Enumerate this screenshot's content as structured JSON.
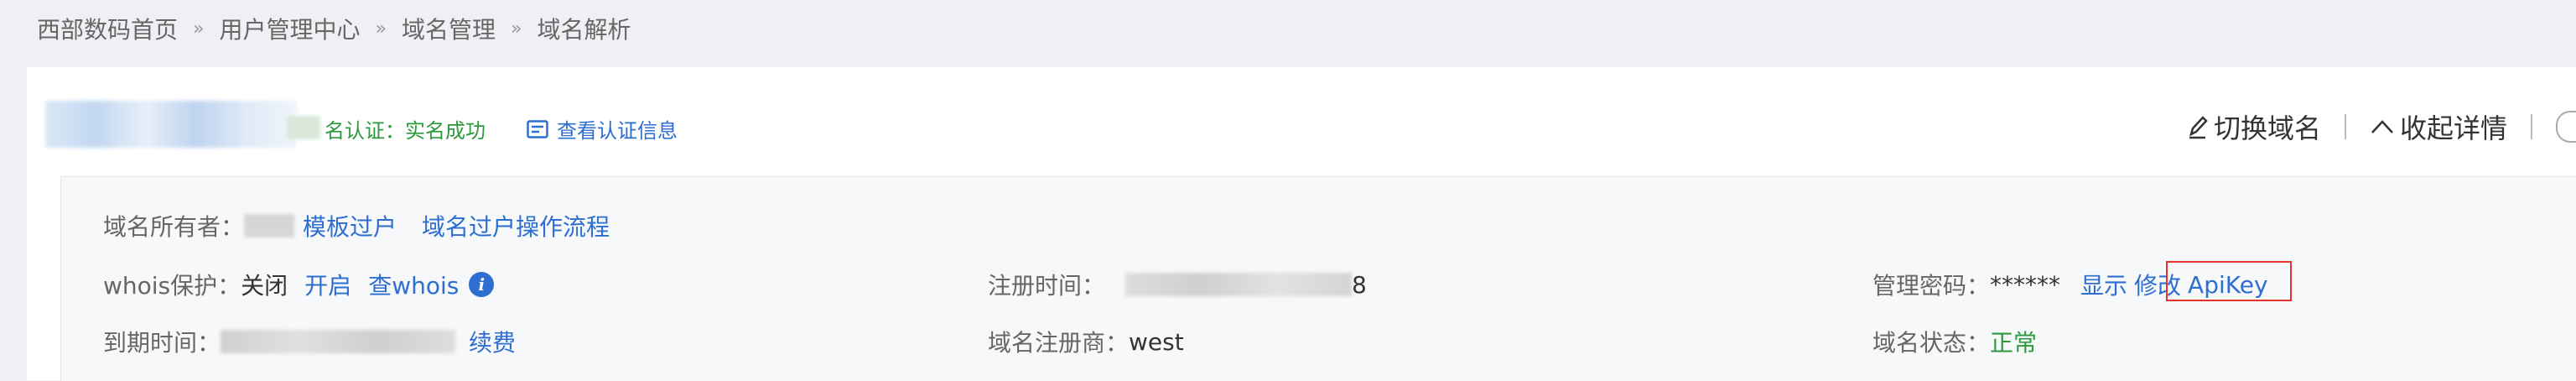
{
  "breadcrumb": [
    "西部数码首页",
    "用户管理中心",
    "域名管理",
    "域名解析"
  ],
  "header": {
    "auth_text": "名认证：实名成功",
    "auth_link": "查看认证信息",
    "switch_domain": "切换域名",
    "collapse": "收起详情"
  },
  "info": {
    "owner_label": "域名所有者：",
    "owner_link_template": "模板过户",
    "owner_link_flow": "域名过户操作流程",
    "whois_label": "whois保护：",
    "whois_value": "关闭",
    "whois_enable": "开启",
    "whois_query": "查whois",
    "info_icon_glyph": "i",
    "reg_time_label": "注册时间：",
    "reg_time_tail": "8",
    "password_label": "管理密码：",
    "password_value": "******",
    "show": "显示",
    "modify": "修改",
    "apikey": "ApiKey",
    "expire_label": "到期时间：",
    "renew": "续费",
    "registrar_label": "域名注册商：",
    "registrar_value": "west",
    "status_label": "域名状态：",
    "status_value": "正常"
  },
  "colors": {
    "link": "#2d6ed0",
    "success": "#2e9a3e",
    "highlight": "#e5322d"
  }
}
